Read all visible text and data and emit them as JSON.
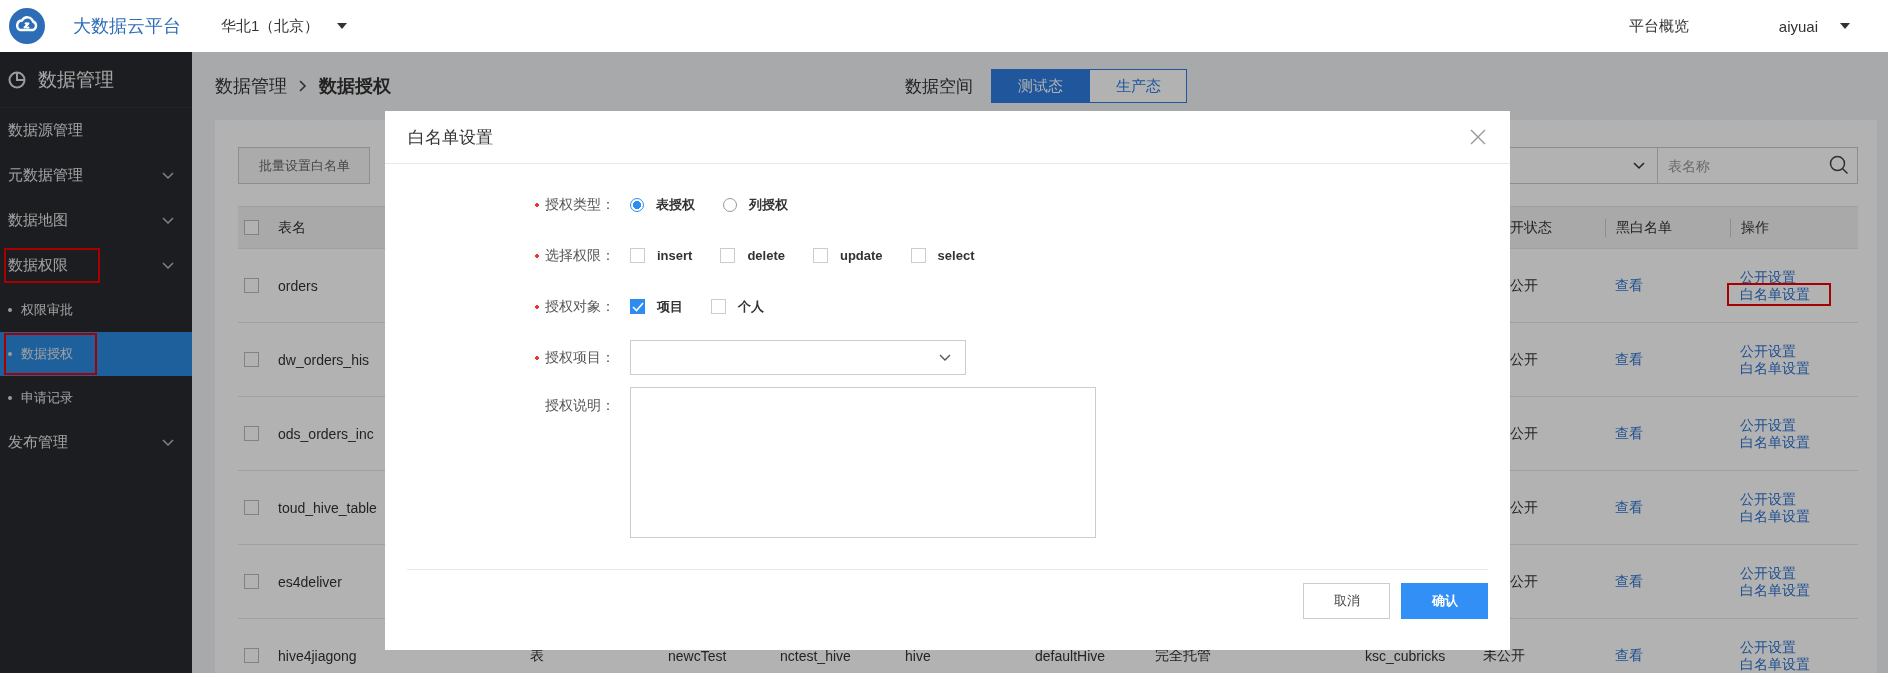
{
  "topbar": {
    "brand": "大数据云平台",
    "region": "华北1（北京）",
    "links": [
      "平台概览"
    ],
    "user": "aiyuai"
  },
  "sidebar": {
    "title": "数据管理",
    "items": [
      {
        "label": "数据源管理",
        "kind": "link",
        "selected": false,
        "highlighted": false
      },
      {
        "label": "元数据管理",
        "kind": "group",
        "selected": false,
        "highlighted": false
      },
      {
        "label": "数据地图",
        "kind": "group",
        "selected": false,
        "highlighted": false
      },
      {
        "label": "数据权限",
        "kind": "group",
        "selected": false,
        "highlighted": true,
        "children": [
          {
            "label": "权限审批",
            "selected": false,
            "highlighted": false
          },
          {
            "label": "数据授权",
            "selected": true,
            "highlighted": true
          },
          {
            "label": "申请记录",
            "selected": false,
            "highlighted": false
          }
        ]
      },
      {
        "label": "发布管理",
        "kind": "group",
        "selected": false,
        "highlighted": false
      }
    ]
  },
  "breadcrumb": [
    "数据管理",
    "数据授权"
  ],
  "data_space": {
    "label": "数据空间",
    "tabs": [
      {
        "label": "测试态",
        "selected": true
      },
      {
        "label": "生产态",
        "selected": false
      }
    ]
  },
  "toolbar": {
    "batch_button": "批量设置白名单",
    "search": {
      "placeholder": "表名称"
    }
  },
  "table": {
    "all_checked": false,
    "columns": {
      "name": "表名",
      "status": "开状态",
      "list": "黑白名单",
      "ops": "操作"
    },
    "rows": [
      {
        "checked": false,
        "name": "orders",
        "status": "公开",
        "list": "查看",
        "actions": [
          {
            "label": "公开设置",
            "highlighted": false
          },
          {
            "label": "白名单设置",
            "highlighted": true
          }
        ]
      },
      {
        "checked": false,
        "name": "dw_orders_his",
        "status": "公开",
        "list": "查看",
        "actions": [
          {
            "label": "公开设置",
            "highlighted": false
          },
          {
            "label": "白名单设置",
            "highlighted": false
          }
        ]
      },
      {
        "checked": false,
        "name": "ods_orders_inc",
        "status": "公开",
        "list": "查看",
        "actions": [
          {
            "label": "公开设置",
            "highlighted": false
          },
          {
            "label": "白名单设置",
            "highlighted": false
          }
        ]
      },
      {
        "checked": false,
        "name": "toud_hive_table",
        "status": "公开",
        "list": "查看",
        "actions": [
          {
            "label": "公开设置",
            "highlighted": false
          },
          {
            "label": "白名单设置",
            "highlighted": false
          }
        ]
      },
      {
        "checked": false,
        "name": "es4deliver",
        "status": "公开",
        "list": "查看",
        "actions": [
          {
            "label": "公开设置",
            "highlighted": false
          },
          {
            "label": "白名单设置",
            "highlighted": false
          }
        ]
      },
      {
        "checked": false,
        "name": "hive4jiagong",
        "cells": [
          "表",
          "newcTest",
          "nctest_hive",
          "hive",
          "defaultHive",
          "完全托管",
          "ksc_cubricks"
        ],
        "status": "未公开",
        "list": "查看",
        "actions": [
          {
            "label": "公开设置",
            "highlighted": false
          },
          {
            "label": "白名单设置",
            "highlighted": false
          }
        ]
      }
    ]
  },
  "dialog": {
    "title": "白名单设置",
    "fields": [
      {
        "kind": "radio",
        "label": "授权类型：",
        "required": true,
        "options": [
          {
            "label": "表授权",
            "selected": true
          },
          {
            "label": "列授权",
            "selected": false
          }
        ]
      },
      {
        "kind": "checkbox",
        "label": "选择权限：",
        "required": true,
        "options": [
          {
            "label": "insert",
            "checked": false
          },
          {
            "label": "delete",
            "checked": false
          },
          {
            "label": "update",
            "checked": false
          },
          {
            "label": "select",
            "checked": false
          }
        ]
      },
      {
        "kind": "checkbox",
        "label": "授权对象：",
        "required": true,
        "options": [
          {
            "label": "项目",
            "checked": true
          },
          {
            "label": "个人",
            "checked": false
          }
        ]
      },
      {
        "kind": "select",
        "label": "授权项目：",
        "required": true
      },
      {
        "kind": "textarea",
        "label": "授权说明：",
        "required": false
      }
    ],
    "buttons": [
      {
        "label": "取消",
        "kind": "secondary"
      },
      {
        "label": "确认",
        "kind": "primary"
      }
    ]
  }
}
